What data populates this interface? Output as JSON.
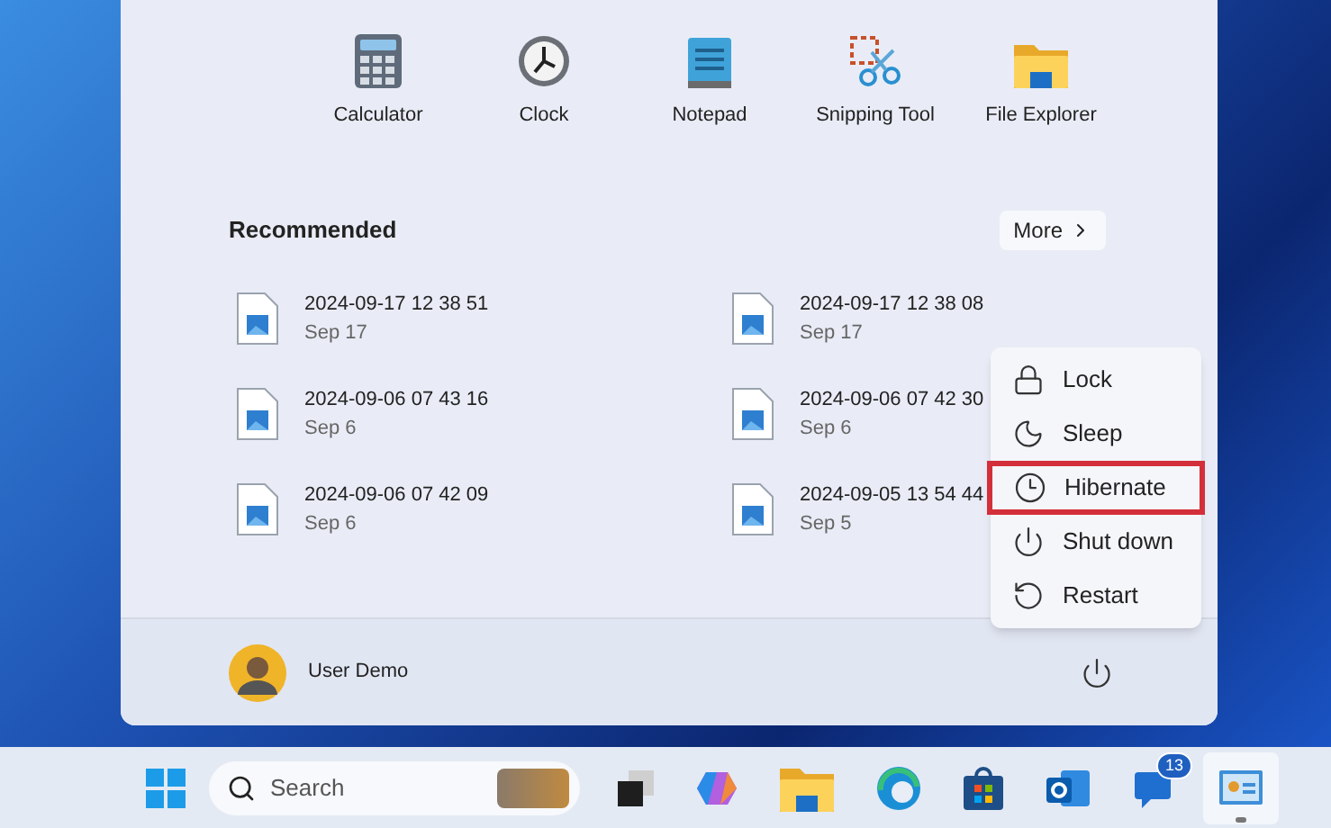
{
  "pinned": [
    {
      "kind": "calculator",
      "label": "Calculator"
    },
    {
      "kind": "clock",
      "label": "Clock"
    },
    {
      "kind": "notepad",
      "label": "Notepad"
    },
    {
      "kind": "snipping",
      "label": "Snipping Tool"
    },
    {
      "kind": "folder",
      "label": "File Explorer"
    }
  ],
  "recommended": {
    "title": "Recommended",
    "more_button": "More",
    "files": [
      {
        "name": "2024-09-17 12 38 51",
        "date": "Sep 17"
      },
      {
        "name": "2024-09-17 12 38 08",
        "date": "Sep 17"
      },
      {
        "name": "2024-09-06 07 43 16",
        "date": "Sep 6"
      },
      {
        "name": "2024-09-06 07 42 30",
        "date": "Sep 6"
      },
      {
        "name": "2024-09-06 07 42 09",
        "date": "Sep 6"
      },
      {
        "name": "2024-09-05 13 54 44",
        "date": "Sep 5"
      }
    ]
  },
  "user": {
    "name": "User Demo"
  },
  "power_menu": [
    {
      "kind": "lock",
      "label": "Lock",
      "selected": false
    },
    {
      "kind": "sleep",
      "label": "Sleep",
      "selected": false
    },
    {
      "kind": "hibernate",
      "label": "Hibernate",
      "selected": true
    },
    {
      "kind": "shutdown",
      "label": "Shut down",
      "selected": false
    },
    {
      "kind": "restart",
      "label": "Restart",
      "selected": false
    }
  ],
  "taskbar": {
    "search_placeholder": "Search",
    "apps": [
      {
        "kind": "taskview",
        "running": false
      },
      {
        "kind": "copilot",
        "running": false
      },
      {
        "kind": "folder",
        "running": false
      },
      {
        "kind": "edge",
        "running": false
      },
      {
        "kind": "store",
        "running": false
      },
      {
        "kind": "outlook",
        "running": false
      },
      {
        "kind": "chat",
        "badge": "13",
        "running": false
      },
      {
        "kind": "control",
        "running": true
      }
    ]
  }
}
